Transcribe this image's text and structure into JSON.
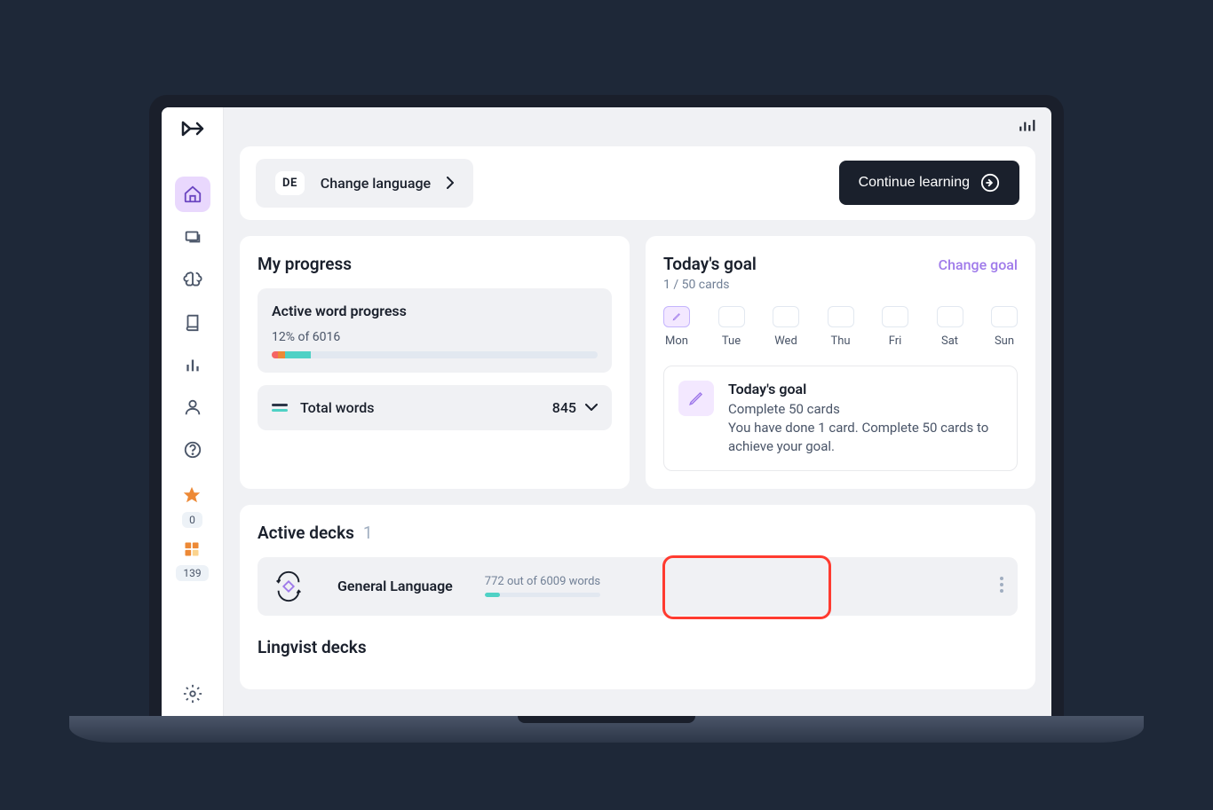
{
  "topbar": {
    "language_code": "DE",
    "change_language_label": "Change language",
    "continue_button": "Continue learning"
  },
  "progress": {
    "title": "My progress",
    "active_title": "Active word progress",
    "active_sub": "12% of 6016",
    "total_label": "Total words",
    "total_value": "845"
  },
  "goal": {
    "title": "Today's goal",
    "change_label": "Change goal",
    "sub": "1 / 50 cards",
    "days": [
      "Mon",
      "Tue",
      "Wed",
      "Thu",
      "Fri",
      "Sat",
      "Sun"
    ],
    "detail_title": "Today's goal",
    "detail_sub": "Complete 50 cards",
    "detail_body": "You have done 1 card. Complete 50 cards to achieve your goal."
  },
  "decks": {
    "active_title": "Active decks",
    "active_count": "1",
    "deck_name": "General Language",
    "deck_progress": "772 out of 6009 words",
    "lingvist_title": "Lingvist decks"
  },
  "sidebar": {
    "star_count": "0",
    "grid_count": "139"
  }
}
